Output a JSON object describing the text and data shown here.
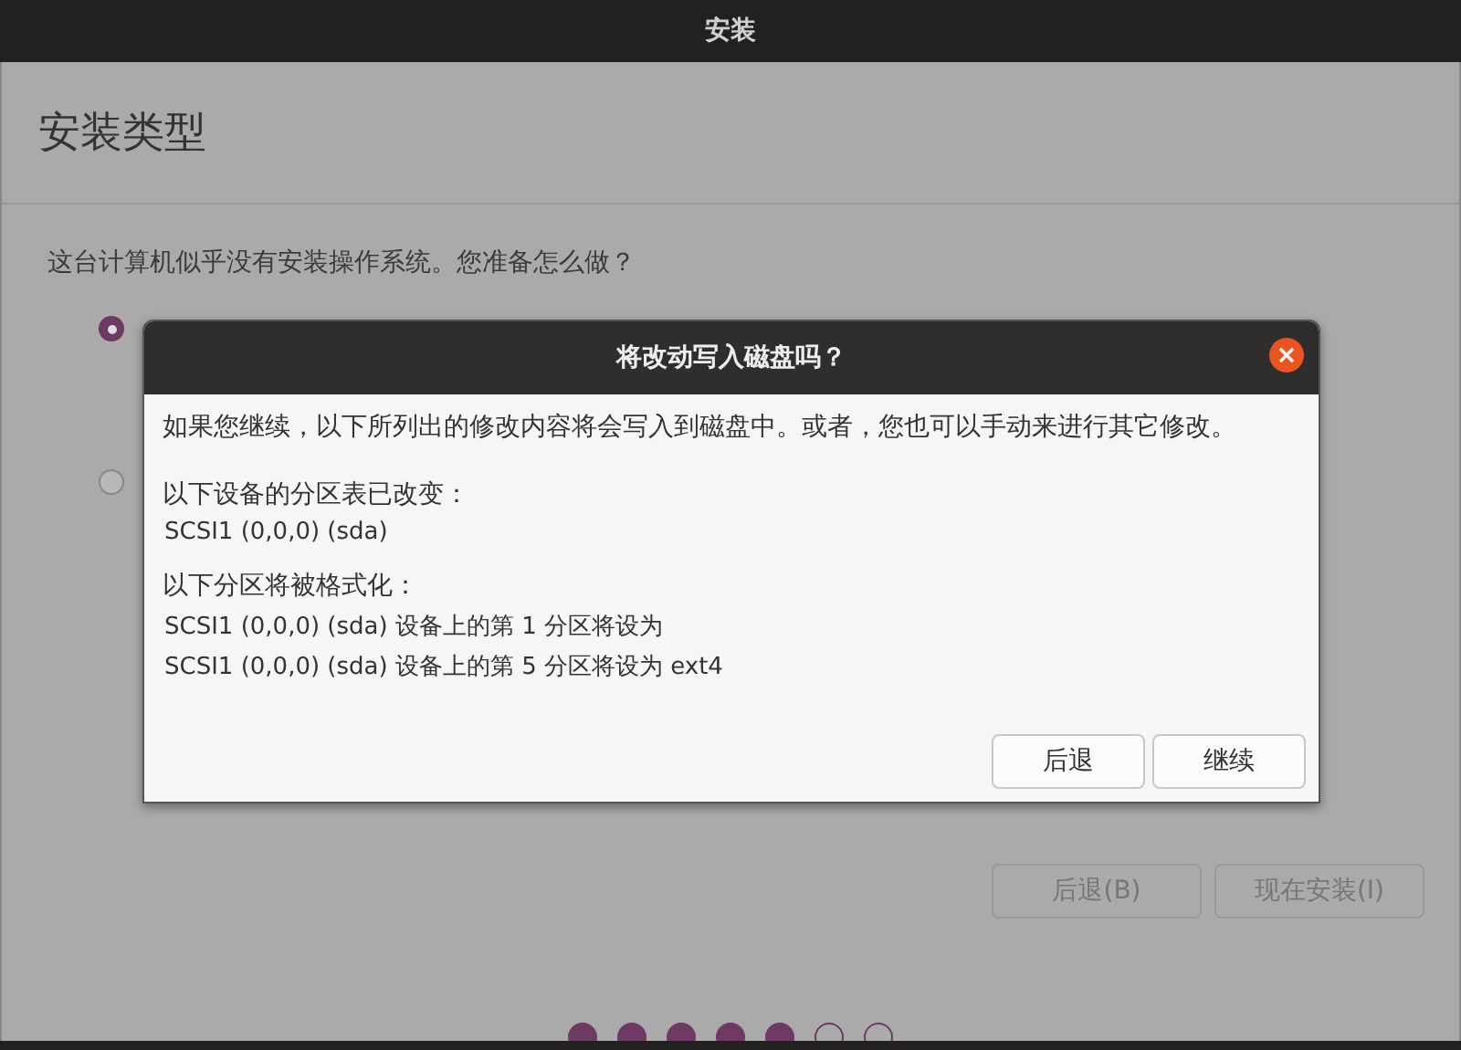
{
  "window": {
    "title": "安装"
  },
  "page": {
    "heading": "安装类型",
    "question": "这台计算机似乎没有安装操作系统。您准备怎么做？",
    "options": [
      {
        "selected": true
      },
      {
        "selected": false
      }
    ],
    "buttons": [
      {
        "label": "后退(B)",
        "disabled": true
      },
      {
        "label": "现在安装(I)",
        "disabled": true
      }
    ],
    "steps": [
      {
        "done": true
      },
      {
        "done": true
      },
      {
        "done": true
      },
      {
        "done": true
      },
      {
        "done": true
      },
      {
        "done": false
      },
      {
        "done": false
      }
    ]
  },
  "dialog": {
    "title": "将改动写入磁盘吗？",
    "intro": "如果您继续，以下所列出的修改内容将会写入到磁盘中。或者，您也可以手动来进行其它修改。",
    "sections": [
      {
        "heading": "以下设备的分区表已改变：",
        "lines": [
          "SCSI1 (0,0,0) (sda)"
        ]
      },
      {
        "heading": "以下分区将被格式化：",
        "lines": [
          "SCSI1 (0,0,0) (sda) 设备上的第 1 分区将设为",
          "SCSI1 (0,0,0) (sda) 设备上的第 5 分区将设为 ext4"
        ]
      }
    ],
    "buttons": [
      "后退",
      "继续"
    ]
  }
}
